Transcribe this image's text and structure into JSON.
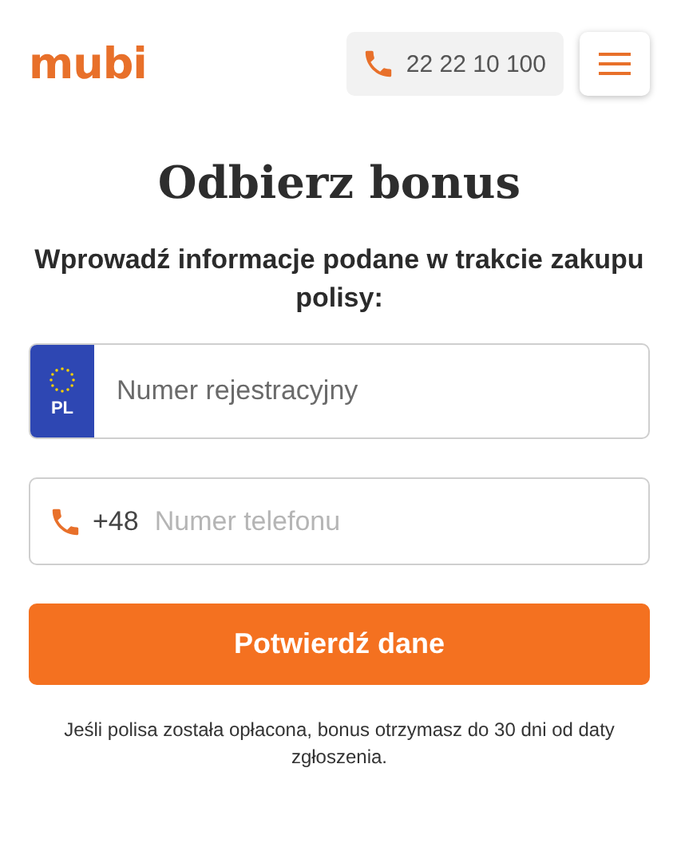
{
  "header": {
    "logo": "mubi",
    "phone": "22 22 10 100"
  },
  "title": "Odbierz bonus",
  "subtitle": "Wprowadź informacje podane w trakcie zakupu polisy:",
  "plate_field": {
    "country": "PL",
    "placeholder": "Numer rejestracyjny"
  },
  "phone_field": {
    "prefix": "+48",
    "placeholder": "Numer telefonu"
  },
  "submit_button": "Potwierdź dane",
  "note": "Jeśli polisa została opłacona, bonus otrzymasz do 30 dni od daty zgłoszenia."
}
